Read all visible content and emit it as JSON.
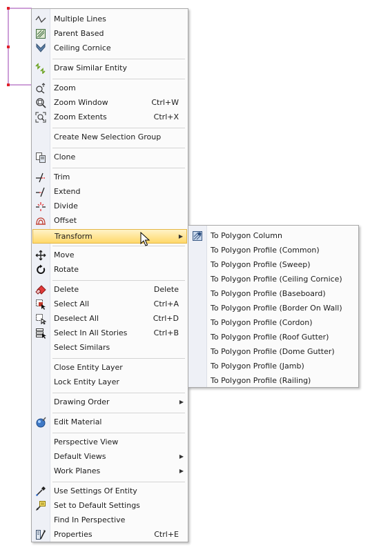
{
  "main_menu": {
    "items": [
      {
        "label": "Multiple Lines",
        "icon": "multiple-lines-icon"
      },
      {
        "label": "Parent Based",
        "icon": "parent-based-icon"
      },
      {
        "label": "Ceiling Cornice",
        "icon": "ceiling-cornice-icon"
      },
      {
        "label": "Draw Similar Entity",
        "icon": "draw-similar-icon"
      },
      {
        "label": "Zoom",
        "icon": "zoom-icon"
      },
      {
        "label": "Zoom Window",
        "shortcut": "Ctrl+W",
        "icon": "zoom-window-icon"
      },
      {
        "label": "Zoom Extents",
        "shortcut": "Ctrl+X",
        "icon": "zoom-extents-icon"
      },
      {
        "label": "Create New Selection Group"
      },
      {
        "label": "Clone",
        "icon": "clone-icon"
      },
      {
        "label": "Trim",
        "icon": "trim-icon"
      },
      {
        "label": "Extend",
        "icon": "extend-icon"
      },
      {
        "label": "Divide",
        "icon": "divide-icon"
      },
      {
        "label": "Offset",
        "icon": "offset-icon"
      },
      {
        "label": "Transform"
      },
      {
        "label": "Move",
        "icon": "move-icon"
      },
      {
        "label": "Rotate",
        "icon": "rotate-icon"
      },
      {
        "label": "Delete",
        "shortcut": "Delete",
        "icon": "eraser-icon"
      },
      {
        "label": "Select All",
        "shortcut": "Ctrl+A",
        "icon": "select-all-icon"
      },
      {
        "label": "Deselect All",
        "shortcut": "Ctrl+D",
        "icon": "deselect-all-icon"
      },
      {
        "label": "Select In All Stories",
        "shortcut": "Ctrl+B",
        "icon": "select-stories-icon"
      },
      {
        "label": "Select Similars"
      },
      {
        "label": "Close Entity Layer"
      },
      {
        "label": "Lock Entity Layer"
      },
      {
        "label": "Drawing Order"
      },
      {
        "label": "Edit Material",
        "icon": "edit-material-icon"
      },
      {
        "label": "Perspective View"
      },
      {
        "label": "Default Views"
      },
      {
        "label": "Work Planes"
      },
      {
        "label": "Use Settings Of Entity",
        "icon": "pipette-icon"
      },
      {
        "label": "Set to Default Settings",
        "icon": "default-settings-icon"
      },
      {
        "label": "Find In Perspective"
      },
      {
        "label": "Properties",
        "shortcut": "Ctrl+E",
        "icon": "properties-icon"
      }
    ],
    "highlighted": "Transform"
  },
  "transform_submenu": {
    "items": [
      {
        "label": "To Polygon Column",
        "icon": "polygon-column-icon"
      },
      {
        "label": "To Polygon Profile (Common)"
      },
      {
        "label": "To Polygon Profile (Sweep)"
      },
      {
        "label": "To Polygon Profile (Ceiling Cornice)"
      },
      {
        "label": "To Polygon Profile (Baseboard)"
      },
      {
        "label": "To Polygon Profile (Border On Wall)"
      },
      {
        "label": "To Polygon Profile (Cordon)"
      },
      {
        "label": "To Polygon Profile (Roof Gutter)"
      },
      {
        "label": "To Polygon Profile (Dome Gutter)"
      },
      {
        "label": "To Polygon Profile (Jamb)"
      },
      {
        "label": "To Polygon Profile (Railing)"
      }
    ]
  },
  "colors": {
    "highlight_top": "#fff3c7",
    "highlight_bottom": "#ffd86a",
    "selection_line": "#9b3fb0",
    "grip": "#e0202a"
  }
}
